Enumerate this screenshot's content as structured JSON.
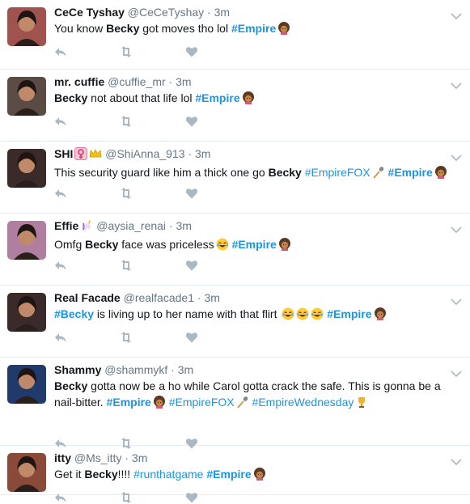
{
  "tweets": [
    {
      "name": "CeCe Tyshay",
      "handle": "@CeCeTyshay",
      "time": "3m",
      "avatar_color": "#a0524f",
      "segments": [
        {
          "t": "You know "
        },
        {
          "t": "Becky",
          "s": "b"
        },
        {
          "t": " got moves tho lol "
        },
        {
          "t": "#Empire",
          "s": "tagb"
        },
        {
          "e": "afro-woman-emoji"
        }
      ]
    },
    {
      "name": "mr. cuffie",
      "handle": "@cuffie_mr",
      "time": "3m",
      "avatar_color": "#5a4b45",
      "segments": [
        {
          "t": "Becky",
          "s": "b"
        },
        {
          "t": " not about  that life lol "
        },
        {
          "t": "#Empire",
          "s": "tagb"
        },
        {
          "e": "afro-woman-emoji"
        }
      ]
    },
    {
      "name": "SHI",
      "handle": "@ShiAnna_913",
      "time": "3m",
      "avatar_color": "#3a2a28",
      "name_emojis": [
        "venus-sign-emoji",
        "crown-emoji"
      ],
      "segments": [
        {
          "t": "This security guard like him a thick one go "
        },
        {
          "t": "Becky",
          "s": "b"
        },
        {
          "t": " "
        },
        {
          "t": "#EmpireFOX",
          "s": "tag"
        },
        {
          "e": "microphone-emoji"
        },
        {
          "t": " "
        },
        {
          "t": "#Empire",
          "s": "tagb"
        },
        {
          "e": "afro-woman-emoji"
        }
      ]
    },
    {
      "name": "Effie",
      "handle": "@aysia_renai",
      "time": "3m",
      "avatar_color": "#b07fa0",
      "name_emojis": [
        "unicorn-emoji"
      ],
      "segments": [
        {
          "t": "Omfg "
        },
        {
          "t": "Becky",
          "s": "b"
        },
        {
          "t": " face was priceless"
        },
        {
          "e": "laughing-emoji"
        },
        {
          "t": " "
        },
        {
          "t": "#Empire",
          "s": "tagb"
        },
        {
          "e": "afro-woman-emoji"
        }
      ]
    },
    {
      "name": "Real Facade",
      "handle": "@realfacade1",
      "time": "3m",
      "avatar_color": "#3b2a2a",
      "segments": [
        {
          "t": "#Becky",
          "s": "tagb"
        },
        {
          "t": " is living up to her name with that flirt "
        },
        {
          "e": "laughing-emoji"
        },
        {
          "e": "laughing-emoji"
        },
        {
          "e": "laughing-emoji"
        },
        {
          "t": " "
        },
        {
          "t": "#Empire",
          "s": "tagb"
        },
        {
          "e": "afro-woman-emoji"
        }
      ]
    },
    {
      "name": "Shammy",
      "handle": "@shammykf",
      "time": "3m",
      "avatar_color": "#1f3a6b",
      "segments": [
        {
          "t": "Becky",
          "s": "b"
        },
        {
          "t": " gotta now be a ho while Carol gotta crack the safe. This is gonna be a nail-bitter. "
        },
        {
          "t": "#Empire",
          "s": "tagb"
        },
        {
          "e": "afro-woman-emoji"
        },
        {
          "t": " "
        },
        {
          "t": "#EmpireFOX",
          "s": "tag"
        },
        {
          "e": "microphone-emoji"
        },
        {
          "t": " "
        },
        {
          "t": "#EmpireWednesday",
          "s": "tag"
        },
        {
          "e": "trophy-emoji"
        }
      ]
    },
    {
      "name": "itty",
      "handle": "@Ms_itty",
      "time": "3m",
      "avatar_color": "#8a4a3a",
      "segments": [
        {
          "t": "Get it "
        },
        {
          "t": "Becky",
          "s": "b"
        },
        {
          "t": "!!!! "
        },
        {
          "t": "#runthatgame",
          "s": "tag"
        },
        {
          "t": " "
        },
        {
          "t": "#Empire",
          "s": "tagb"
        },
        {
          "e": "afro-woman-emoji"
        }
      ]
    }
  ],
  "layout_note_free": true
}
